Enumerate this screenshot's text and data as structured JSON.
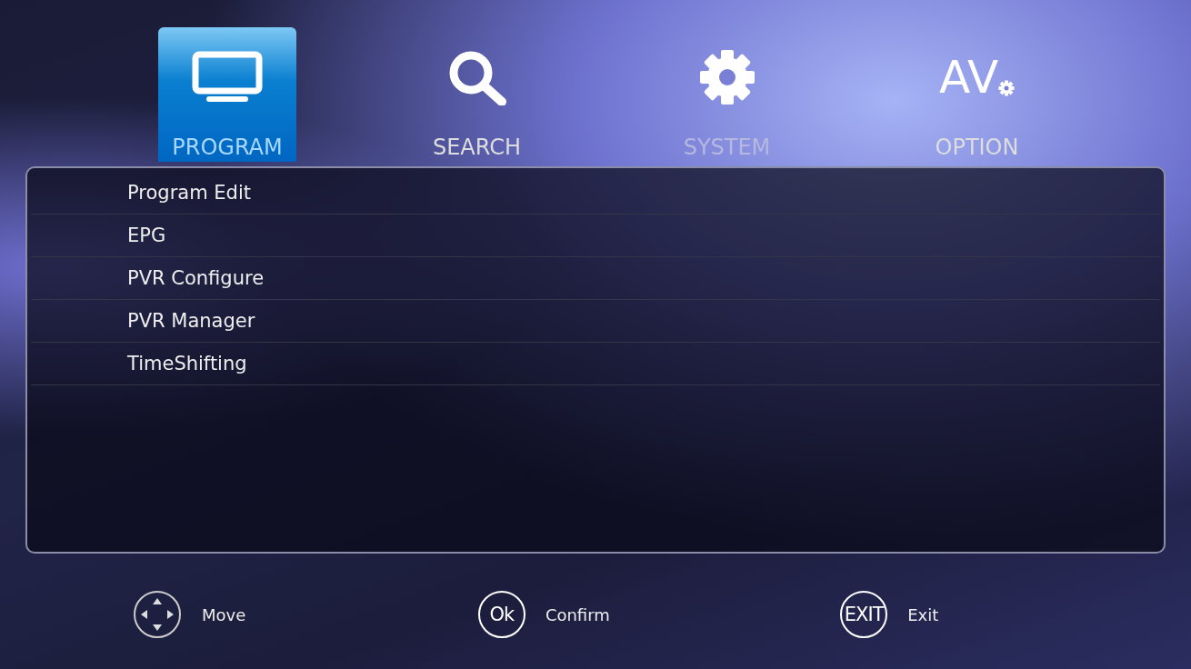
{
  "tabs": [
    {
      "label": "PROGRAM",
      "kind": "monitor",
      "selected": true
    },
    {
      "label": "SEARCH",
      "kind": "search",
      "selected": false
    },
    {
      "label": "SYSTEM",
      "kind": "gear",
      "selected": false
    },
    {
      "label": "OPTION",
      "kind": "av",
      "icon_text": "AV",
      "selected": false
    }
  ],
  "menu": {
    "items": [
      {
        "label": "Program Edit"
      },
      {
        "label": "EPG"
      },
      {
        "label": "PVR Configure"
      },
      {
        "label": "PVR Manager"
      },
      {
        "label": "TimeShifting"
      }
    ]
  },
  "hints": [
    {
      "kind": "dpad",
      "label": "Move"
    },
    {
      "kind": "ok",
      "icon_text": "Ok",
      "label": "Confirm"
    },
    {
      "kind": "exit",
      "icon_text": "EXIT",
      "label": "Exit"
    }
  ]
}
